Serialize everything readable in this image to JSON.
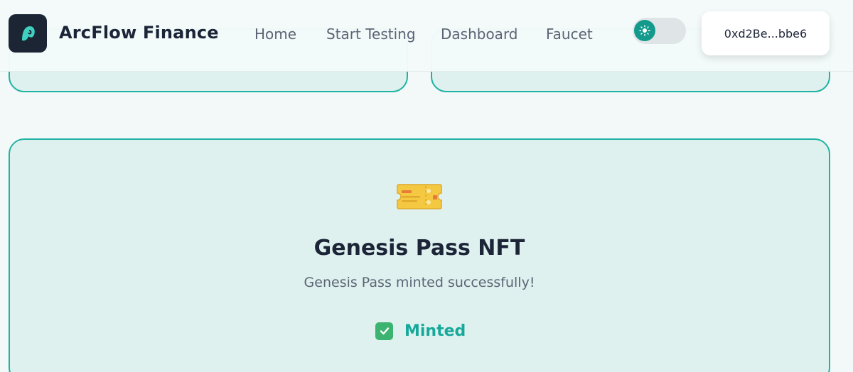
{
  "header": {
    "brand": "ArcFlow Finance",
    "nav": [
      "Home",
      "Start Testing",
      "Dashboard",
      "Faucet"
    ],
    "wallet": "0xd2Be...bbe6",
    "theme_toggle_icon": "sun-icon"
  },
  "card": {
    "icon": "ticket-icon",
    "title": "Genesis Pass NFT",
    "description": "Genesis Pass minted successfully!",
    "status_icon": "check-mark-icon",
    "status": "Minted"
  },
  "colors": {
    "accent": "#1fb3a3",
    "card_bg": "#dff1ef",
    "page_bg": "#f3f8f8",
    "text_dark": "#1c2537",
    "status_green": "#17a89a"
  }
}
